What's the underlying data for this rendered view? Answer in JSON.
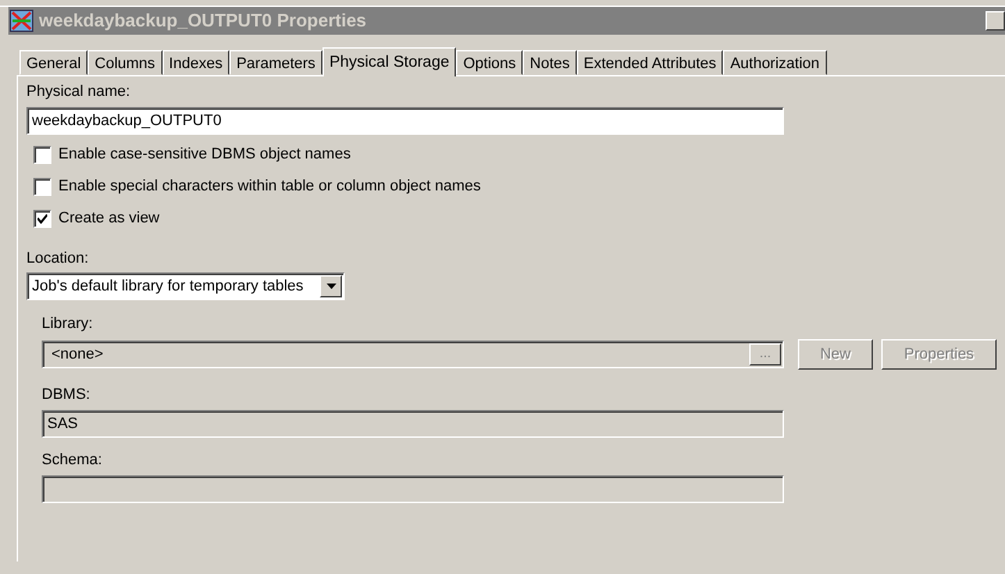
{
  "window": {
    "title": "weekdaybackup_OUTPUT0 Properties"
  },
  "tabs": [
    {
      "label": "General",
      "selected": false
    },
    {
      "label": "Columns",
      "selected": false
    },
    {
      "label": "Indexes",
      "selected": false
    },
    {
      "label": "Parameters",
      "selected": false
    },
    {
      "label": "Physical Storage",
      "selected": true
    },
    {
      "label": "Options",
      "selected": false
    },
    {
      "label": "Notes",
      "selected": false
    },
    {
      "label": "Extended Attributes",
      "selected": false
    },
    {
      "label": "Authorization",
      "selected": false
    }
  ],
  "physical_name": {
    "label": "Physical name:",
    "value": "weekdaybackup_OUTPUT0"
  },
  "checkboxes": [
    {
      "label": "Enable case-sensitive DBMS object names",
      "checked": false
    },
    {
      "label": "Enable special characters within table or column object names",
      "checked": false
    },
    {
      "label": "Create as view",
      "checked": true
    }
  ],
  "location": {
    "label": "Location:",
    "value": "Job's default library for temporary tables"
  },
  "library": {
    "label": "Library:",
    "value": "<none>",
    "browse": "...",
    "buttons": [
      {
        "label": "New",
        "disabled": true
      },
      {
        "label": "Properties",
        "disabled": true
      }
    ]
  },
  "dbms": {
    "label": "DBMS:",
    "value": "SAS"
  },
  "schema": {
    "label": "Schema:"
  }
}
